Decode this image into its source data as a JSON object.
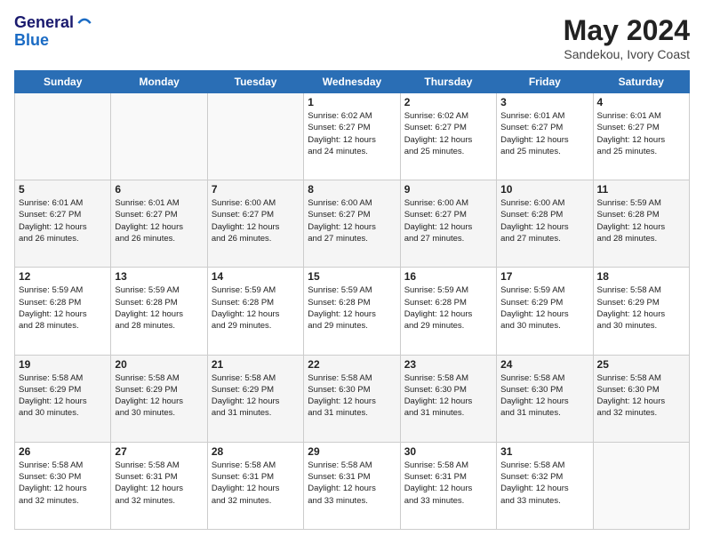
{
  "header": {
    "logo_line1": "General",
    "logo_line2": "Blue",
    "month": "May 2024",
    "location": "Sandekou, Ivory Coast"
  },
  "weekdays": [
    "Sunday",
    "Monday",
    "Tuesday",
    "Wednesday",
    "Thursday",
    "Friday",
    "Saturday"
  ],
  "weeks": [
    [
      {
        "day": "",
        "info": ""
      },
      {
        "day": "",
        "info": ""
      },
      {
        "day": "",
        "info": ""
      },
      {
        "day": "1",
        "info": "Sunrise: 6:02 AM\nSunset: 6:27 PM\nDaylight: 12 hours\nand 24 minutes."
      },
      {
        "day": "2",
        "info": "Sunrise: 6:02 AM\nSunset: 6:27 PM\nDaylight: 12 hours\nand 25 minutes."
      },
      {
        "day": "3",
        "info": "Sunrise: 6:01 AM\nSunset: 6:27 PM\nDaylight: 12 hours\nand 25 minutes."
      },
      {
        "day": "4",
        "info": "Sunrise: 6:01 AM\nSunset: 6:27 PM\nDaylight: 12 hours\nand 25 minutes."
      }
    ],
    [
      {
        "day": "5",
        "info": "Sunrise: 6:01 AM\nSunset: 6:27 PM\nDaylight: 12 hours\nand 26 minutes."
      },
      {
        "day": "6",
        "info": "Sunrise: 6:01 AM\nSunset: 6:27 PM\nDaylight: 12 hours\nand 26 minutes."
      },
      {
        "day": "7",
        "info": "Sunrise: 6:00 AM\nSunset: 6:27 PM\nDaylight: 12 hours\nand 26 minutes."
      },
      {
        "day": "8",
        "info": "Sunrise: 6:00 AM\nSunset: 6:27 PM\nDaylight: 12 hours\nand 27 minutes."
      },
      {
        "day": "9",
        "info": "Sunrise: 6:00 AM\nSunset: 6:27 PM\nDaylight: 12 hours\nand 27 minutes."
      },
      {
        "day": "10",
        "info": "Sunrise: 6:00 AM\nSunset: 6:28 PM\nDaylight: 12 hours\nand 27 minutes."
      },
      {
        "day": "11",
        "info": "Sunrise: 5:59 AM\nSunset: 6:28 PM\nDaylight: 12 hours\nand 28 minutes."
      }
    ],
    [
      {
        "day": "12",
        "info": "Sunrise: 5:59 AM\nSunset: 6:28 PM\nDaylight: 12 hours\nand 28 minutes."
      },
      {
        "day": "13",
        "info": "Sunrise: 5:59 AM\nSunset: 6:28 PM\nDaylight: 12 hours\nand 28 minutes."
      },
      {
        "day": "14",
        "info": "Sunrise: 5:59 AM\nSunset: 6:28 PM\nDaylight: 12 hours\nand 29 minutes."
      },
      {
        "day": "15",
        "info": "Sunrise: 5:59 AM\nSunset: 6:28 PM\nDaylight: 12 hours\nand 29 minutes."
      },
      {
        "day": "16",
        "info": "Sunrise: 5:59 AM\nSunset: 6:28 PM\nDaylight: 12 hours\nand 29 minutes."
      },
      {
        "day": "17",
        "info": "Sunrise: 5:59 AM\nSunset: 6:29 PM\nDaylight: 12 hours\nand 30 minutes."
      },
      {
        "day": "18",
        "info": "Sunrise: 5:58 AM\nSunset: 6:29 PM\nDaylight: 12 hours\nand 30 minutes."
      }
    ],
    [
      {
        "day": "19",
        "info": "Sunrise: 5:58 AM\nSunset: 6:29 PM\nDaylight: 12 hours\nand 30 minutes."
      },
      {
        "day": "20",
        "info": "Sunrise: 5:58 AM\nSunset: 6:29 PM\nDaylight: 12 hours\nand 30 minutes."
      },
      {
        "day": "21",
        "info": "Sunrise: 5:58 AM\nSunset: 6:29 PM\nDaylight: 12 hours\nand 31 minutes."
      },
      {
        "day": "22",
        "info": "Sunrise: 5:58 AM\nSunset: 6:30 PM\nDaylight: 12 hours\nand 31 minutes."
      },
      {
        "day": "23",
        "info": "Sunrise: 5:58 AM\nSunset: 6:30 PM\nDaylight: 12 hours\nand 31 minutes."
      },
      {
        "day": "24",
        "info": "Sunrise: 5:58 AM\nSunset: 6:30 PM\nDaylight: 12 hours\nand 31 minutes."
      },
      {
        "day": "25",
        "info": "Sunrise: 5:58 AM\nSunset: 6:30 PM\nDaylight: 12 hours\nand 32 minutes."
      }
    ],
    [
      {
        "day": "26",
        "info": "Sunrise: 5:58 AM\nSunset: 6:30 PM\nDaylight: 12 hours\nand 32 minutes."
      },
      {
        "day": "27",
        "info": "Sunrise: 5:58 AM\nSunset: 6:31 PM\nDaylight: 12 hours\nand 32 minutes."
      },
      {
        "day": "28",
        "info": "Sunrise: 5:58 AM\nSunset: 6:31 PM\nDaylight: 12 hours\nand 32 minutes."
      },
      {
        "day": "29",
        "info": "Sunrise: 5:58 AM\nSunset: 6:31 PM\nDaylight: 12 hours\nand 33 minutes."
      },
      {
        "day": "30",
        "info": "Sunrise: 5:58 AM\nSunset: 6:31 PM\nDaylight: 12 hours\nand 33 minutes."
      },
      {
        "day": "31",
        "info": "Sunrise: 5:58 AM\nSunset: 6:32 PM\nDaylight: 12 hours\nand 33 minutes."
      },
      {
        "day": "",
        "info": ""
      }
    ]
  ]
}
